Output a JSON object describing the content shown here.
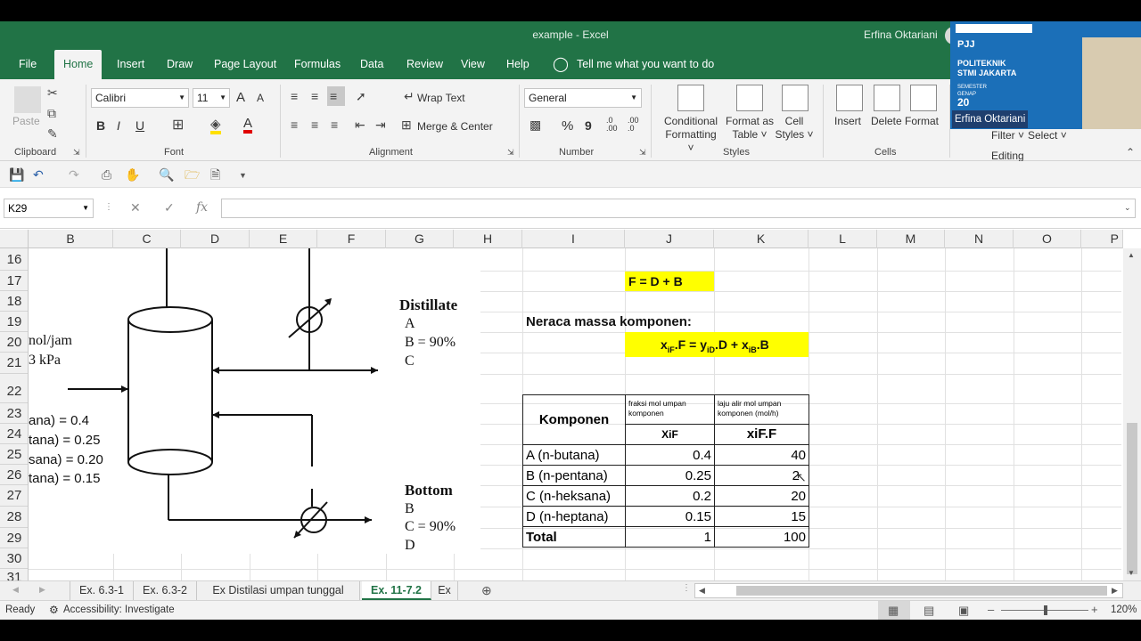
{
  "window": {
    "doc_title": "example  -  Excel",
    "user": "Erfina Oktariani"
  },
  "tabs": [
    "File",
    "Home",
    "Insert",
    "Draw",
    "Page Layout",
    "Formulas",
    "Data",
    "Review",
    "View",
    "Help"
  ],
  "active_tab": "Home",
  "tell_me": "Tell me what you want to do",
  "ribbon": {
    "clipboard": {
      "paste": "Paste",
      "label": "Clipboard"
    },
    "font": {
      "name": "Calibri",
      "size": "11",
      "label": "Font",
      "bold": "B",
      "italic": "I",
      "underline": "U",
      "grow": "A",
      "shrink": "A"
    },
    "alignment": {
      "wrap": "Wrap Text",
      "merge": "Merge & Center",
      "label": "Alignment"
    },
    "number": {
      "format": "General",
      "percent": "%",
      "comma": "9",
      "label": "Number"
    },
    "styles": {
      "conditional_1": "Conditional",
      "conditional_2": "Formatting",
      "format_as_1": "Format as",
      "format_as_2": "Table",
      "cell_1": "Cell",
      "cell_2": "Styles",
      "label": "Styles"
    },
    "cells": {
      "insert": "Insert",
      "delete": "Delete",
      "format": "Format",
      "label": "Cells"
    },
    "editing": {
      "filter": "Filter",
      "select": "Select",
      "label": "Editing"
    }
  },
  "overlay": {
    "org_1": "POLITEKNIK",
    "org_2": "STMI JAKARTA",
    "presenter": "Erfina Oktariani",
    "semester_label": "SEMESTER",
    "semester_sub": "GENAP",
    "year": "20"
  },
  "formula_bar": {
    "name_box": "K29",
    "fx": "fx",
    "formula": ""
  },
  "columns": [
    "B",
    "C",
    "D",
    "E",
    "F",
    "G",
    "H",
    "I",
    "J",
    "K",
    "L",
    "M",
    "N",
    "O",
    "P"
  ],
  "rows": [
    "16",
    "17",
    "18",
    "19",
    "20",
    "21",
    "22",
    "23",
    "24",
    "25",
    "26",
    "27",
    "28",
    "29",
    "30",
    "31"
  ],
  "sheet": {
    "formula_total": "F = D + B",
    "heading": "Neraca massa komponen:",
    "component_eq": {
      "x": "x",
      "x_sub": "iF",
      "p1": ".F = y",
      "y_sub": "iD",
      "p2": ".D + x",
      "x2_sub": "iB",
      "p3": ".B"
    },
    "table": {
      "header_komponen": "Komponen",
      "header_fraksi": "fraksi mol umpan komponen",
      "header_laju": "laju alir mol umpan komponen (mol/h)",
      "sub_xif": "XiF",
      "sub_xiff": "xiF.F",
      "rows": [
        {
          "name": "A (n-butana)",
          "xif": "0.4",
          "flow": "40"
        },
        {
          "name": "B (n-pentana)",
          "xif": "0.25",
          "flow": "2"
        },
        {
          "name": "C (n-heksana)",
          "xif": "0.2",
          "flow": "20"
        },
        {
          "name": "D (n-heptana)",
          "xif": "0.15",
          "flow": "15"
        }
      ],
      "total_label": "Total",
      "total_xif": "1",
      "total_flow": "100"
    }
  },
  "diagram": {
    "feed_1": "nol/jam",
    "feed_2": "3 kPa",
    "feed_comp": [
      "ana) = 0.4",
      "tana) = 0.25",
      "sana) = 0.20",
      "tana) = 0.15"
    ],
    "distillate": "Distillate",
    "distillate_items": [
      "A",
      "B = 90%",
      "C"
    ],
    "bottom": "Bottom",
    "bottom_items": [
      "B",
      "C = 90%",
      "D"
    ]
  },
  "sheet_tabs": [
    "Ex. 6.3-1",
    "Ex. 6.3-2",
    "Ex Distilasi umpan tunggal",
    "Ex. 11-7.2",
    "Ex"
  ],
  "active_sheet": "Ex. 11-7.2",
  "status": {
    "ready": "Ready",
    "accessibility": "Accessibility: Investigate",
    "zoom": "120%"
  }
}
